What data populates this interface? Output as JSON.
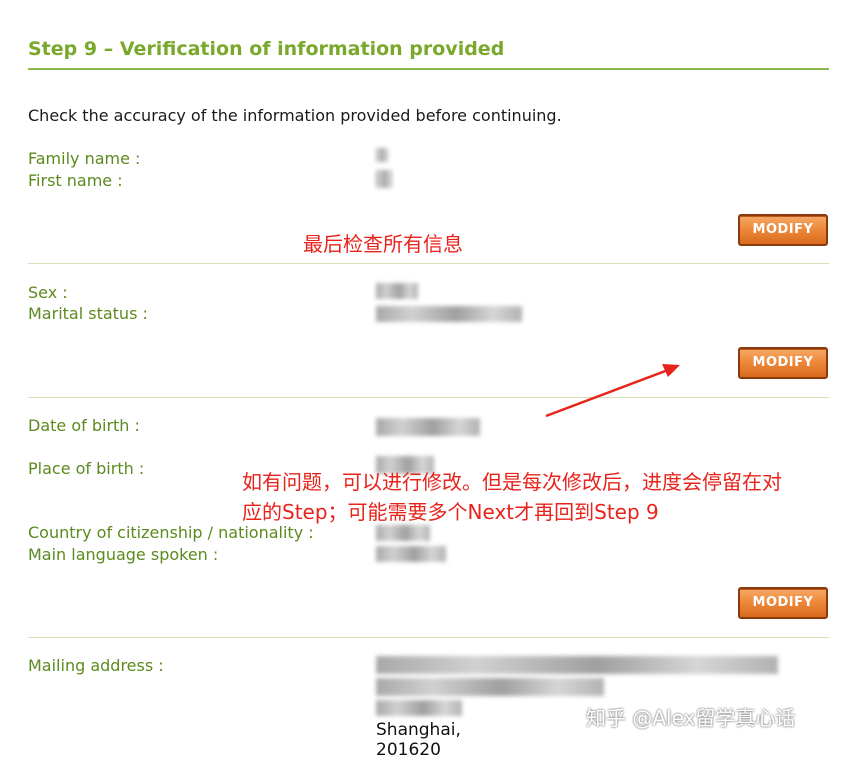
{
  "title": "Step 9 – Verification of information provided",
  "intro": "Check the accuracy of the information provided before continuing.",
  "labels": {
    "family_name": "Family name :",
    "first_name": "First name :",
    "sex": "Sex :",
    "marital_status": "Marital status :",
    "date_of_birth": "Date of birth :",
    "place_of_birth": "Place of birth :",
    "country_of_citizenship": "Country of citizenship / nationality :",
    "main_language": "Main language spoken :",
    "mailing_address": "Mailing address :"
  },
  "buttons": {
    "modify": "MODIFY"
  },
  "address": {
    "city": "Shanghai,",
    "postal": "201620"
  },
  "annotations": {
    "note1": "最后检查所有信息",
    "note2_line1": "如有问题，可以进行修改。但是每次修改后，进度会停留在对",
    "note2_line2": "应的Step；可能需要多个Next才再回到Step 9"
  },
  "watermark": "知乎 @Alex留学真心话",
  "colors": {
    "title_green": "#7aa82a",
    "label_green": "#5b8a1e",
    "button_orange": "#ee8a3c",
    "annotation_red": "#e8231b"
  }
}
